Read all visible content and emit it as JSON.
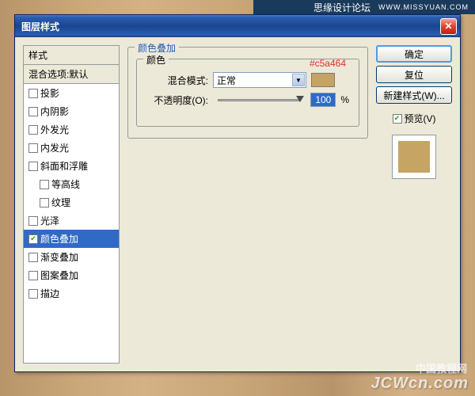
{
  "header": {
    "site": "思缘设计论坛",
    "url": "WWW.MISSYUAN.COM"
  },
  "dialog": {
    "title": "图层样式"
  },
  "left": {
    "styles_header": "样式",
    "blend_defaults": "混合选项:默认",
    "items": [
      {
        "label": "投影",
        "checked": false,
        "selected": false
      },
      {
        "label": "内阴影",
        "checked": false,
        "selected": false
      },
      {
        "label": "外发光",
        "checked": false,
        "selected": false
      },
      {
        "label": "内发光",
        "checked": false,
        "selected": false
      },
      {
        "label": "斜面和浮雕",
        "checked": false,
        "selected": false
      },
      {
        "label": "等高线",
        "checked": false,
        "selected": false,
        "sub": true
      },
      {
        "label": "纹理",
        "checked": false,
        "selected": false,
        "sub": true
      },
      {
        "label": "光泽",
        "checked": false,
        "selected": false
      },
      {
        "label": "颜色叠加",
        "checked": true,
        "selected": true
      },
      {
        "label": "渐变叠加",
        "checked": false,
        "selected": false
      },
      {
        "label": "图案叠加",
        "checked": false,
        "selected": false
      },
      {
        "label": "描边",
        "checked": false,
        "selected": false
      }
    ]
  },
  "mid": {
    "section_title": "颜色叠加",
    "color_group": "颜色",
    "hex_label": "#c5a464",
    "blend_mode_label": "混合模式:",
    "blend_mode_value": "正常",
    "opacity_label": "不透明度(O):",
    "opacity_value": "100",
    "opacity_unit": "%",
    "swatch_color": "#c5a464"
  },
  "right": {
    "ok": "确定",
    "reset": "复位",
    "new_style": "新建样式(W)...",
    "preview": "预览(V)",
    "preview_checked": true
  },
  "watermark": {
    "line1": "中国教程网",
    "line2": "JCWcn.com"
  }
}
